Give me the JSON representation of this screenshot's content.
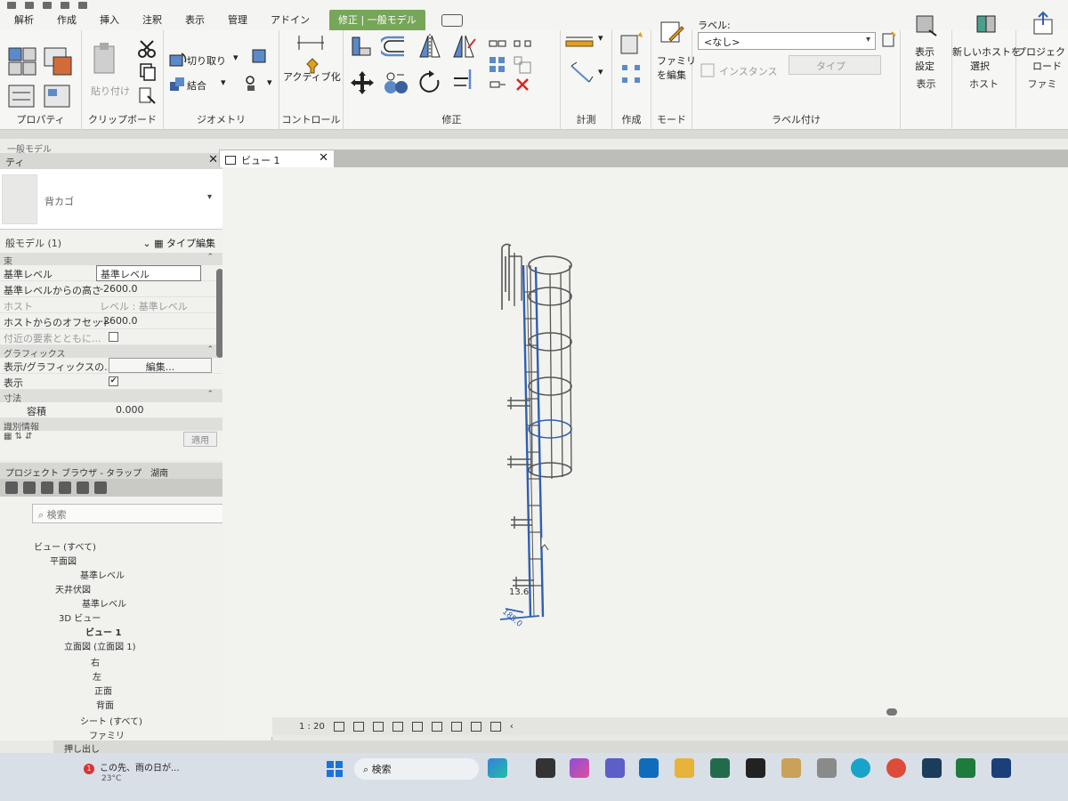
{
  "tabs": {
    "items": [
      "解析",
      "作成",
      "挿入",
      "注釈",
      "表示",
      "管理",
      "アドイン"
    ],
    "context_tab": "修正 | 一般モデル"
  },
  "ribbon": {
    "panels": {
      "properties": "プロパティ",
      "clipboard": "クリップボード",
      "geometry": "ジオメトリ",
      "controls": "コントロール",
      "modify": "修正",
      "measure": "計測",
      "create": "作成",
      "mode": "モード",
      "label": "ラベル付け",
      "view": "表示",
      "host": "ホスト",
      "family": "ファミ"
    },
    "paste": "貼り付け",
    "cut": "切り取り",
    "join": "結合",
    "activate": "アクティブ化",
    "edit_family_1": "ファミリ",
    "edit_family_2": "を編集",
    "label_caption": "ラベル:",
    "label_value": "<なし>",
    "instance": "インスタンス",
    "type": "タイプ",
    "view_settings_1": "表示",
    "view_settings_2": "設定",
    "new_host_1": "新しいホストを",
    "new_host_2": "選択",
    "load_project_1": "プロジェクトに",
    "load_project_2": "ロード"
  },
  "crumb": "一般モデル",
  "properties_panel": {
    "title": "ティ",
    "type_name": "背カゴ",
    "selection": "般モデル (1)",
    "edit_type": "タイプ編集",
    "groups": {
      "constraints": "束",
      "graphics": "グラフィックス",
      "dimensions": "寸法",
      "identity": "識別情報"
    },
    "rows": [
      {
        "k": "基準レベル",
        "v": "基準レベル"
      },
      {
        "k": "基準レベルからの高さ",
        "v": "-2600.0"
      },
      {
        "k": "ホスト",
        "v": "レベル : 基準レベル"
      },
      {
        "k": "ホストからのオフセット",
        "v": "-2600.0"
      },
      {
        "k": "付近の要素とともに...",
        "v": ""
      },
      {
        "k": "表示/グラフィックスの...",
        "v": "編集..."
      },
      {
        "k": "表示",
        "v": "✔"
      },
      {
        "k": "容積",
        "v": "0.000"
      }
    ],
    "apply": "適用"
  },
  "browser": {
    "title": "プロジェクト ブラウザ - タラップ　湖南",
    "search_placeholder": "検索",
    "tree": [
      "ビュー (すべて)",
      "平面図",
      "基準レベル",
      "天井伏図",
      "基準レベル",
      "3D ビュー",
      "ビュー 1",
      "立面図 (立面図 1)",
      "右",
      "左",
      "正面",
      "背面",
      "シート (すべて)",
      "ファミリ"
    ]
  },
  "view": {
    "tab_title": "ビュー 1",
    "scale": "1 : 20",
    "dim_1": "13.6",
    "dim_2": "185.0"
  },
  "status": "押し出し",
  "taskbar": {
    "weather_line": "この先、雨の日が...",
    "weather_temp": "23°C",
    "badge": "1",
    "search": "検索"
  },
  "colors": {
    "context_tab": "#76a658",
    "selection_blue": "#2f5fb3"
  }
}
